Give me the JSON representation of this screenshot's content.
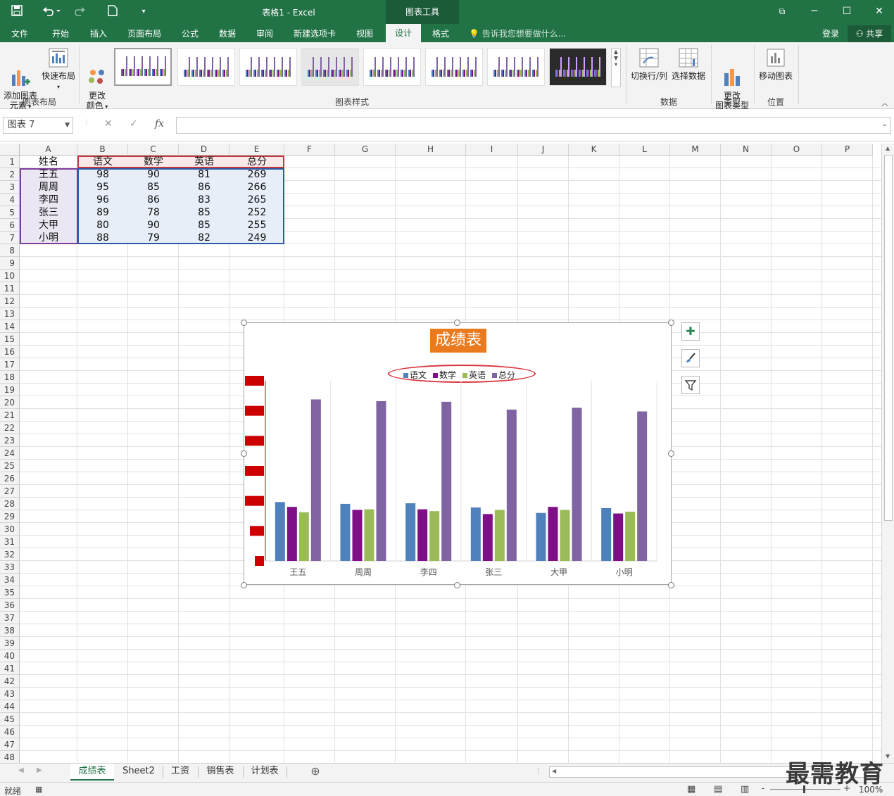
{
  "titlebar": {
    "doc_title": "表格1 - Excel",
    "chart_tools": "图表工具",
    "save_icon": "save-icon",
    "undo_icon": "undo-icon",
    "redo_icon": "redo-icon",
    "new_icon": "new-file-icon",
    "customize": "▾",
    "restore": "⧉",
    "minimize": "─",
    "maximize": "☐",
    "close": "✕"
  },
  "tabs": [
    {
      "label": "文件"
    },
    {
      "label": "开始"
    },
    {
      "label": "插入"
    },
    {
      "label": "页面布局"
    },
    {
      "label": "公式"
    },
    {
      "label": "数据"
    },
    {
      "label": "审阅"
    },
    {
      "label": "新建选项卡"
    },
    {
      "label": "视图"
    },
    {
      "label": "设计"
    },
    {
      "label": "格式"
    }
  ],
  "tell_me": "告诉我您想要做什么...",
  "login": "登录",
  "share": "共享",
  "ribbon": {
    "add_element": "添加图表\n元素",
    "quick_layout": "快速布局",
    "change_color": "更改\n颜色",
    "group_layout": "图表布局",
    "group_styles": "图表样式",
    "switch_row_col": "切换行/列",
    "select_data": "选择数据",
    "group_data": "数据",
    "change_type": "更改\n图表类型",
    "group_type": "类型",
    "move_chart": "移动图表",
    "group_location": "位置"
  },
  "formula_bar": {
    "name_box": "图表 7",
    "cancel": "✕",
    "enter": "✓",
    "fx": "fx",
    "value": ""
  },
  "columns": [
    "A",
    "B",
    "C",
    "D",
    "E",
    "F",
    "G",
    "H",
    "I",
    "J",
    "K",
    "L",
    "M",
    "N",
    "O",
    "P"
  ],
  "rows": [
    "1",
    "2",
    "3",
    "4",
    "5",
    "6",
    "7",
    "8",
    "9",
    "10",
    "11",
    "12",
    "13",
    "14",
    "15",
    "16",
    "17",
    "18",
    "19",
    "20",
    "21",
    "22",
    "23",
    "24",
    "25",
    "26",
    "27",
    "28",
    "29",
    "30",
    "31",
    "32",
    "33",
    "34",
    "35",
    "36",
    "37",
    "38",
    "39",
    "40",
    "41",
    "42",
    "43",
    "44",
    "45",
    "46",
    "47",
    "48"
  ],
  "table": {
    "headers": [
      "姓名",
      "语文",
      "数学",
      "英语",
      "总分"
    ],
    "rows": [
      [
        "王五",
        "98",
        "90",
        "81",
        "269"
      ],
      [
        "周周",
        "95",
        "85",
        "86",
        "266"
      ],
      [
        "李四",
        "96",
        "86",
        "83",
        "265"
      ],
      [
        "张三",
        "89",
        "78",
        "85",
        "252"
      ],
      [
        "大甲",
        "80",
        "90",
        "85",
        "255"
      ],
      [
        "小明",
        "88",
        "79",
        "82",
        "249"
      ]
    ]
  },
  "chart_data": {
    "type": "bar",
    "title": "成绩表",
    "categories": [
      "王五",
      "周周",
      "李四",
      "张三",
      "大甲",
      "小明"
    ],
    "series": [
      {
        "name": "语文",
        "color": "#4f81bd",
        "values": [
          98,
          95,
          96,
          89,
          80,
          88
        ]
      },
      {
        "name": "数学",
        "color": "#7f0f86",
        "values": [
          90,
          85,
          86,
          78,
          90,
          79
        ]
      },
      {
        "name": "英语",
        "color": "#9bbb59",
        "values": [
          81,
          86,
          83,
          85,
          85,
          82
        ]
      },
      {
        "name": "总分",
        "color": "#8064a2",
        "values": [
          269,
          266,
          265,
          252,
          255,
          249
        ]
      }
    ],
    "ylim": [
      0,
      300
    ],
    "ytick_values": [
      0,
      50,
      100,
      150,
      200,
      250,
      300
    ],
    "ytick_color": "#cc0000",
    "legend_position": "top",
    "grid": "vertical"
  },
  "sheet_tabs": [
    "成绩表",
    "Sheet2",
    "工资",
    "销售表",
    "计划表"
  ],
  "add_sheet": "⊕",
  "status": {
    "ready": "就绪",
    "zoom": "100%",
    "minus": "-",
    "plus": "+"
  },
  "watermark": "最需教育"
}
